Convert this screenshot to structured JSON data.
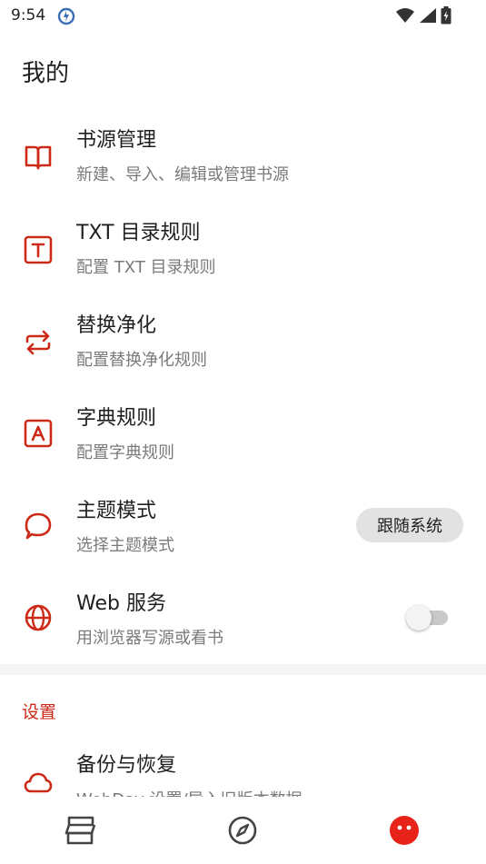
{
  "status_bar": {
    "time": "9:54",
    "icons": [
      "wifi-icon",
      "cellular-signal-icon",
      "battery-charging-icon"
    ]
  },
  "page": {
    "title": "我的"
  },
  "accent_color": "#cc2a17",
  "items": [
    {
      "icon": "book-open-icon",
      "title": "书源管理",
      "subtitle": "新建、导入、编辑或管理书源"
    },
    {
      "icon": "text-t-box-icon",
      "title": "TXT 目录规则",
      "subtitle": "配置 TXT 目录规则"
    },
    {
      "icon": "swap-arrows-icon",
      "title": "替换净化",
      "subtitle": "配置替换净化规则"
    },
    {
      "icon": "letter-a-box-icon",
      "title": "字典规则",
      "subtitle": "配置字典规则"
    },
    {
      "icon": "speech-bubble-icon",
      "title": "主题模式",
      "subtitle": "选择主题模式",
      "value": "跟随系统"
    },
    {
      "icon": "globe-icon",
      "title": "Web 服务",
      "subtitle": "用浏览器写源或看书",
      "switch_on": false
    }
  ],
  "settings": {
    "header": "设置",
    "items": [
      {
        "icon": "cloud-icon",
        "title": "备份与恢复",
        "subtitle": "WebDav 设置/导入旧版本数据"
      }
    ]
  },
  "bottom_nav": {
    "tabs": [
      {
        "icon": "bookshelf-icon",
        "active": false
      },
      {
        "icon": "compass-icon",
        "active": false
      },
      {
        "icon": "my-face-icon",
        "active": true
      }
    ]
  }
}
